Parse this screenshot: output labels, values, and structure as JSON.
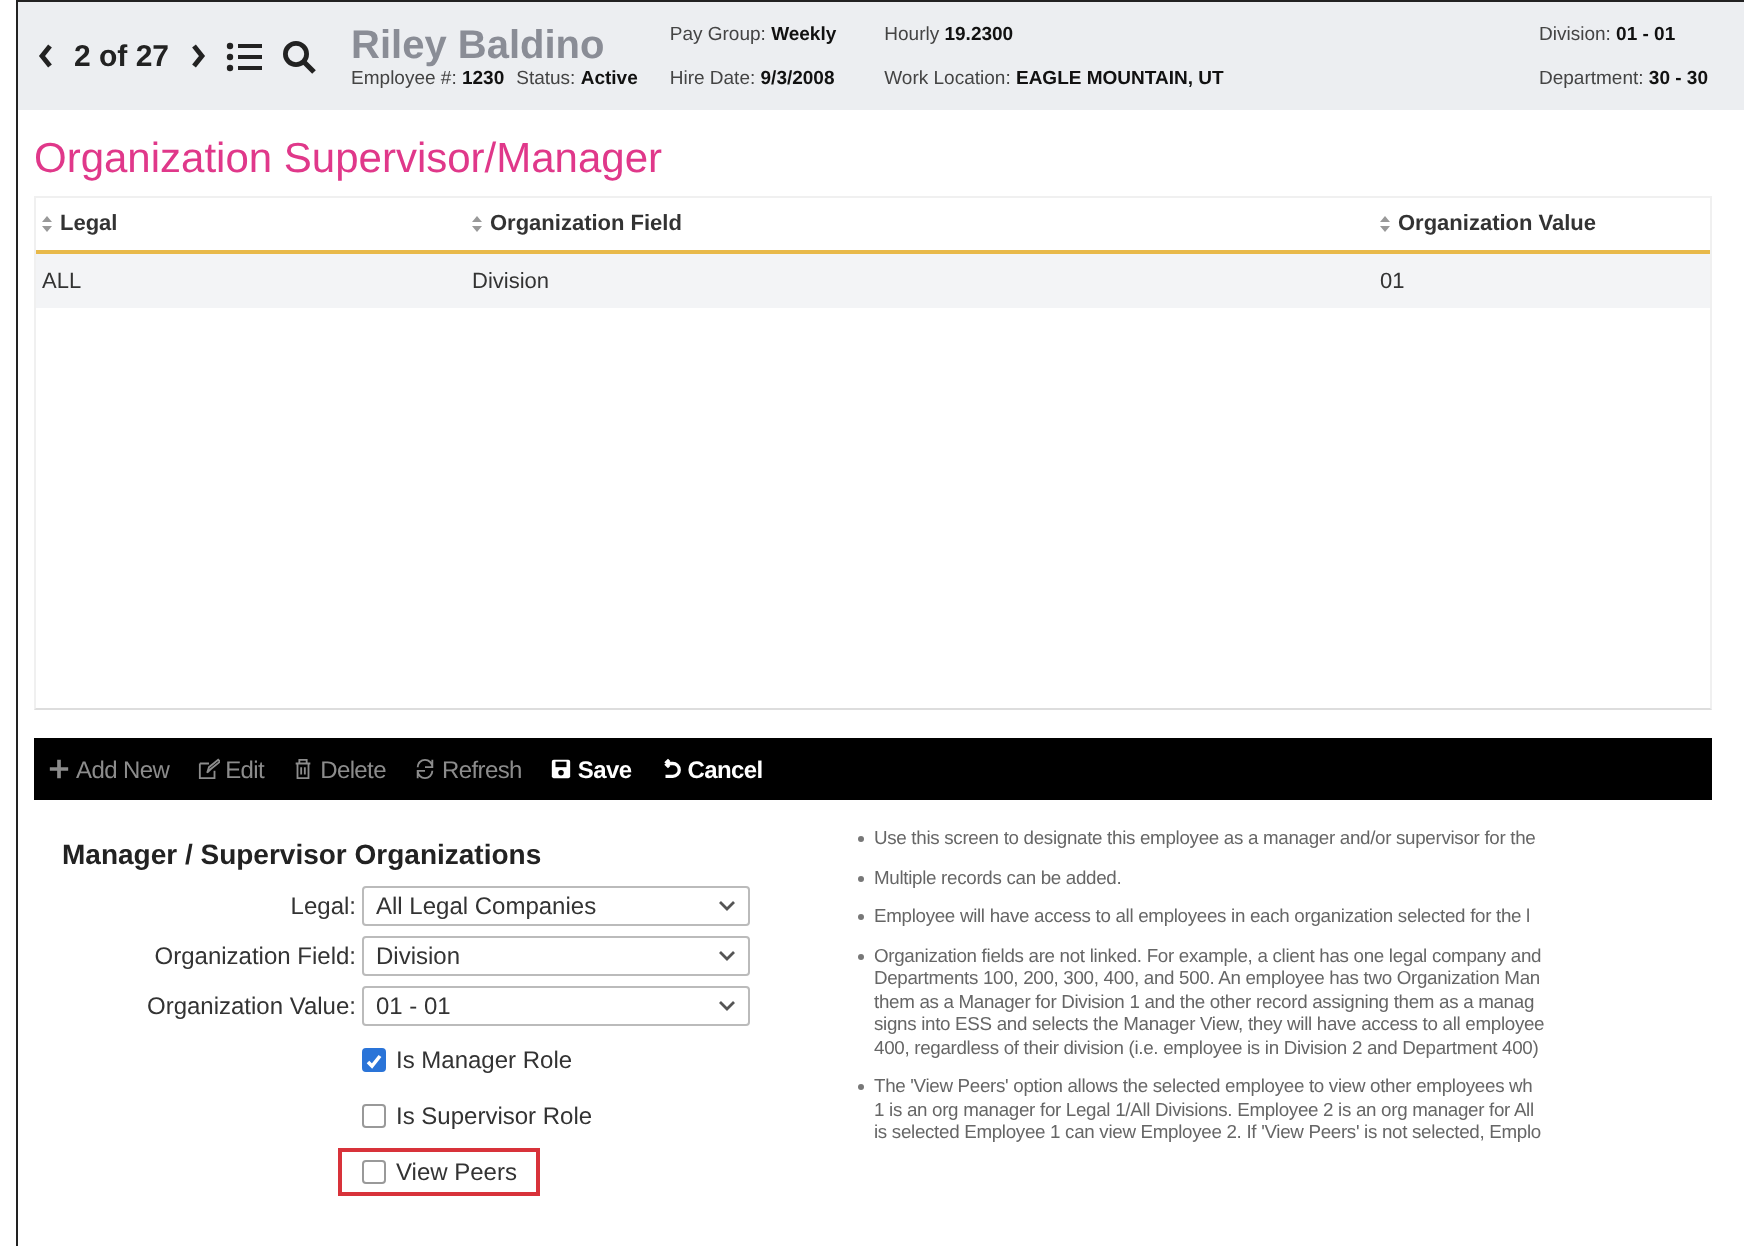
{
  "header": {
    "position": "2 of 27",
    "name": "Riley Baldino",
    "name_fields": [
      {
        "label": "Employee #:",
        "value": "1230"
      },
      {
        "label": "Status:",
        "value": "Active"
      }
    ],
    "columns": [
      [
        {
          "label": "Pay Group:",
          "value": "Weekly"
        },
        {
          "label": "Hire Date:",
          "value": "9/3/2008"
        }
      ],
      [
        {
          "label": "Hourly",
          "value": "19.2300"
        },
        {
          "label": "Work Location:",
          "value": "EAGLE MOUNTAIN, UT"
        }
      ],
      [
        {
          "label": "Division:",
          "value": "01 - 01"
        },
        {
          "label": "Department:",
          "value": "30 - 30"
        }
      ]
    ]
  },
  "page_title": "Organization Supervisor/Manager",
  "table": {
    "columns": [
      "Legal",
      "Organization Field",
      "Organization Value"
    ],
    "rows": [
      {
        "cells": [
          "ALL",
          "Division",
          "01"
        ],
        "selected": true
      }
    ]
  },
  "toolbar": [
    {
      "kind": "add",
      "label": "Add New",
      "disabled": true
    },
    {
      "kind": "edit",
      "label": "Edit",
      "disabled": true
    },
    {
      "kind": "delete",
      "label": "Delete",
      "disabled": true
    },
    {
      "kind": "refresh",
      "label": "Refresh",
      "disabled": true
    },
    {
      "kind": "save",
      "label": "Save",
      "disabled": false
    },
    {
      "kind": "cancel",
      "label": "Cancel",
      "disabled": false
    }
  ],
  "form": {
    "title": "Manager / Supervisor Organizations",
    "fields": [
      {
        "label": "Legal:",
        "value": "All Legal Companies"
      },
      {
        "label": "Organization Field:",
        "value": "Division"
      },
      {
        "label": "Organization Value:",
        "value": "01 - 01"
      }
    ],
    "checkboxes": [
      {
        "label": "Is Manager Role",
        "checked": true,
        "highlighted": false
      },
      {
        "label": "Is Supervisor Role",
        "checked": false,
        "highlighted": false
      },
      {
        "label": "View Peers",
        "checked": false,
        "highlighted": true
      }
    ]
  },
  "help": [
    [
      "Use this screen to designate this employee as a manager and/or supervisor for the"
    ],
    [
      "Multiple records can be added."
    ],
    [
      "Employee will have access to all employees in each organization selected for the l"
    ],
    [
      "Organization fields are not linked. For example, a client has one legal company and",
      "Departments 100, 200, 300, 400, and 500. An employee has two Organization Man",
      "them as a Manager for Division 1 and the other record assigning them as a manag",
      "signs into ESS and selects the Manager View, they will have access to all employee",
      "400, regardless of their division (i.e. employee is in Division 2 and Department 400)"
    ],
    [
      "The 'View Peers' option allows the selected employee to view other employees wh",
      "1 is an org manager for Legal 1/All Divisions. Employee 2 is an org manager for All",
      "is selected Employee 1 can view Employee 2. If 'View Peers' is not selected, Emplo"
    ]
  ]
}
